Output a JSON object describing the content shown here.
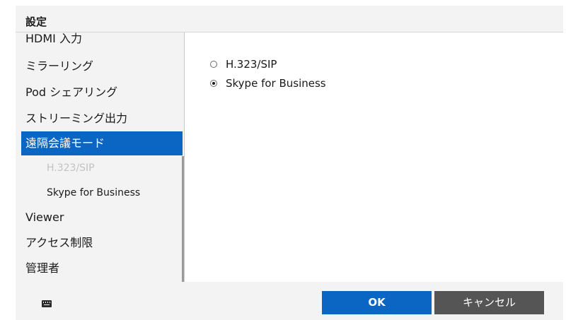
{
  "dialog": {
    "title": "設定"
  },
  "sidebar": {
    "items": [
      {
        "label": "HDMI 入力",
        "state": "normal",
        "level": 0
      },
      {
        "label": "ミラーリング",
        "state": "normal",
        "level": 0
      },
      {
        "label": "Pod シェアリング",
        "state": "normal",
        "level": 0
      },
      {
        "label": "ストリーミング出力",
        "state": "normal",
        "level": 0
      },
      {
        "label": "遠隔会議モード",
        "state": "selected",
        "level": 0
      },
      {
        "label": "H.323/SIP",
        "state": "disabled",
        "level": 1
      },
      {
        "label": "Skype for Business",
        "state": "normal",
        "level": 1
      },
      {
        "label": "Viewer",
        "state": "normal",
        "level": 0
      },
      {
        "label": "アクセス制限",
        "state": "normal",
        "level": 0
      },
      {
        "label": "管理者",
        "state": "normal",
        "level": 0
      }
    ]
  },
  "panel": {
    "options": [
      {
        "label": "H.323/SIP",
        "checked": false
      },
      {
        "label": "Skype for Business",
        "checked": true
      }
    ]
  },
  "footer": {
    "keyboard_icon": "keyboard-icon",
    "ok_label": "OK",
    "cancel_label": "キャンセル"
  },
  "colors": {
    "accent": "#0a66c2",
    "cancel_button": "#555555",
    "background": "#f3f3f3",
    "disabled_text": "#c2c2c2"
  }
}
